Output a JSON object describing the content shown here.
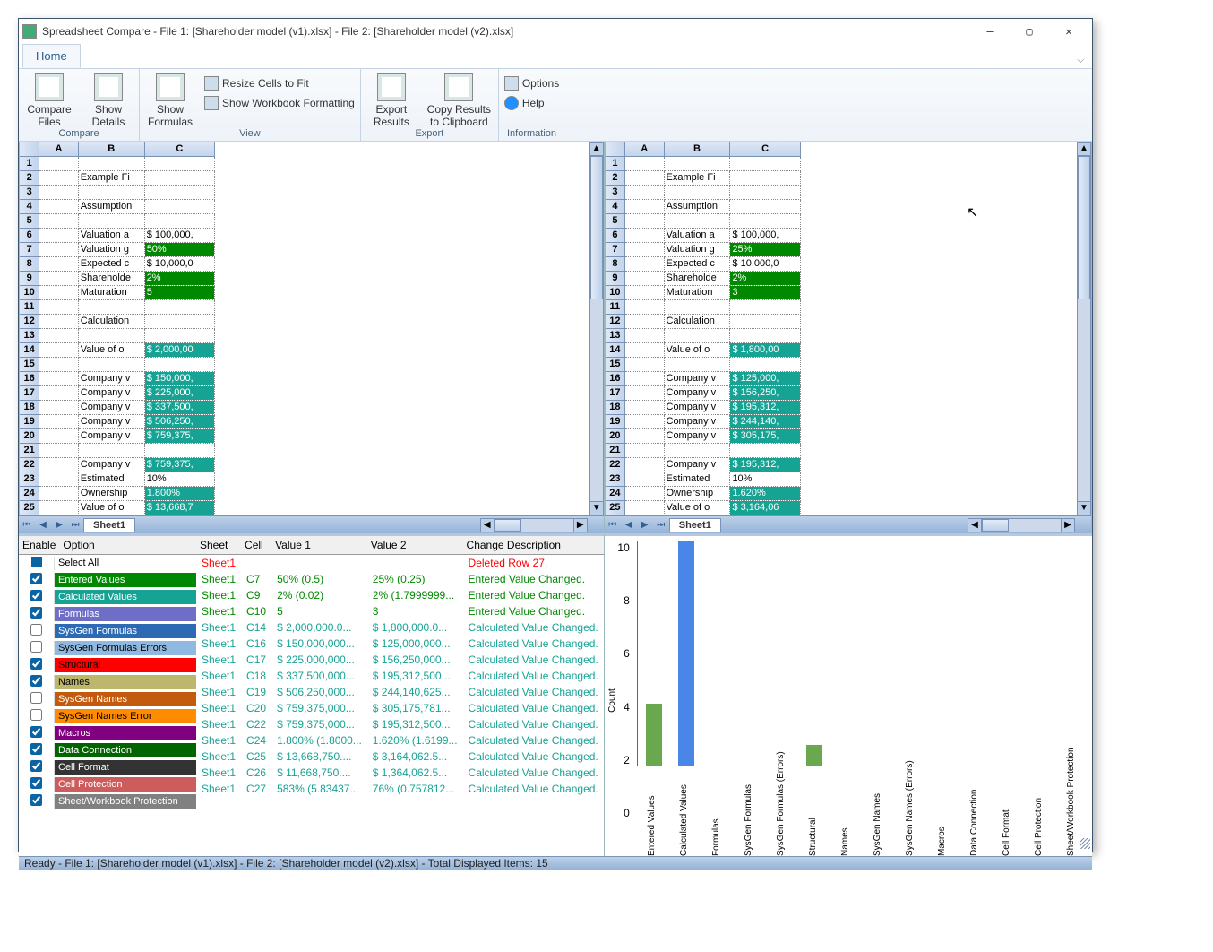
{
  "title": "Spreadsheet Compare - File 1: [Shareholder model (v1).xlsx] - File 2: [Shareholder model (v2).xlsx]",
  "ribbon": {
    "tab": "Home",
    "groups": {
      "compare": {
        "label": "Compare",
        "compare_files": "Compare Files",
        "show_details": "Show Details"
      },
      "view": {
        "label": "View",
        "show_formulas": "Show Formulas",
        "resize": "Resize Cells to Fit",
        "show_wb": "Show Workbook Formatting"
      },
      "export": {
        "label": "Export",
        "export_results": "Export Results",
        "copy_clip": "Copy Results to Clipboard"
      },
      "info": {
        "label": "Information",
        "options": "Options",
        "help": "Help"
      }
    }
  },
  "sheet_cols": [
    "A",
    "B",
    "C"
  ],
  "sheet1_rows": [
    [
      "1",
      "",
      "",
      ""
    ],
    [
      "2",
      "",
      "Example Fi",
      ""
    ],
    [
      "3",
      "",
      "",
      ""
    ],
    [
      "4",
      "",
      "Assumption",
      ""
    ],
    [
      "5",
      "",
      "",
      ""
    ],
    [
      "6",
      "",
      "Valuation a",
      "$ 100,000,"
    ],
    [
      "7",
      "",
      "Valuation g",
      "50%",
      "green"
    ],
    [
      "8",
      "",
      "Expected c",
      "$ 10,000,0"
    ],
    [
      "9",
      "",
      "Shareholde",
      "2%",
      "green"
    ],
    [
      "10",
      "",
      "Maturation",
      "5",
      "green"
    ],
    [
      "11",
      "",
      "",
      ""
    ],
    [
      "12",
      "",
      "Calculation",
      ""
    ],
    [
      "13",
      "",
      "",
      ""
    ],
    [
      "14",
      "",
      "Value of o",
      "$ 2,000,00",
      "teal"
    ],
    [
      "15",
      "",
      "",
      ""
    ],
    [
      "16",
      "",
      "Company v",
      "$ 150,000,",
      "teal"
    ],
    [
      "17",
      "",
      "Company v",
      "$ 225,000,",
      "teal"
    ],
    [
      "18",
      "",
      "Company v",
      "$ 337,500,",
      "teal"
    ],
    [
      "19",
      "",
      "Company v",
      "$ 506,250,",
      "teal"
    ],
    [
      "20",
      "",
      "Company v",
      "$ 759,375,",
      "teal"
    ],
    [
      "21",
      "",
      "",
      ""
    ],
    [
      "22",
      "",
      "Company v",
      "$ 759,375,",
      "teal"
    ],
    [
      "23",
      "",
      "Estimated",
      "10%"
    ],
    [
      "24",
      "",
      "Ownership",
      "1.800%",
      "teal"
    ],
    [
      "25",
      "",
      "Value of o",
      "$ 13,668,7",
      "teal"
    ]
  ],
  "sheet2_rows": [
    [
      "1",
      "",
      "",
      ""
    ],
    [
      "2",
      "",
      "Example Fi",
      ""
    ],
    [
      "3",
      "",
      "",
      ""
    ],
    [
      "4",
      "",
      "Assumption",
      ""
    ],
    [
      "5",
      "",
      "",
      ""
    ],
    [
      "6",
      "",
      "Valuation a",
      "$ 100,000,"
    ],
    [
      "7",
      "",
      "Valuation g",
      "25%",
      "green"
    ],
    [
      "8",
      "",
      "Expected c",
      "$ 10,000,0"
    ],
    [
      "9",
      "",
      "Shareholde",
      "2%",
      "green"
    ],
    [
      "10",
      "",
      "Maturation",
      "3",
      "green"
    ],
    [
      "11",
      "",
      "",
      ""
    ],
    [
      "12",
      "",
      "Calculation",
      ""
    ],
    [
      "13",
      "",
      "",
      ""
    ],
    [
      "14",
      "",
      "Value of o",
      "$ 1,800,00",
      "teal"
    ],
    [
      "15",
      "",
      "",
      ""
    ],
    [
      "16",
      "",
      "Company v",
      "$ 125,000,",
      "teal"
    ],
    [
      "17",
      "",
      "Company v",
      "$ 156,250,",
      "teal"
    ],
    [
      "18",
      "",
      "Company v",
      "$ 195,312,",
      "teal"
    ],
    [
      "19",
      "",
      "Company v",
      "$ 244,140,",
      "teal"
    ],
    [
      "20",
      "",
      "Company v",
      "$ 305,175,",
      "teal"
    ],
    [
      "21",
      "",
      "",
      ""
    ],
    [
      "22",
      "",
      "Company v",
      "$ 195,312,",
      "teal"
    ],
    [
      "23",
      "",
      "Estimated",
      "10%"
    ],
    [
      "24",
      "",
      "Ownership",
      "1.620%",
      "teal"
    ],
    [
      "25",
      "",
      "Value of o",
      "$ 3,164,06",
      "teal"
    ]
  ],
  "sheet_tab": "Sheet1",
  "options": {
    "header_enable": "Enable",
    "header_option": "Option",
    "items": [
      {
        "on": false,
        "label": "Select All",
        "bg": "#fff",
        "fg": "#000",
        "cb_blue": true
      },
      {
        "on": true,
        "label": "Entered Values",
        "bg": "#008800",
        "fg": "#fff"
      },
      {
        "on": true,
        "label": "Calculated Values",
        "bg": "#17a394",
        "fg": "#fff"
      },
      {
        "on": true,
        "label": "Formulas",
        "bg": "#6e6ec7",
        "fg": "#fff"
      },
      {
        "on": false,
        "label": "SysGen Formulas",
        "bg": "#2e69b3",
        "fg": "#fff"
      },
      {
        "on": false,
        "label": "SysGen Formulas Errors",
        "bg": "#8fb9e0",
        "fg": "#000"
      },
      {
        "on": true,
        "label": "Structural",
        "bg": "#ff0000",
        "fg": "#000"
      },
      {
        "on": true,
        "label": "Names",
        "bg": "#bdb76b",
        "fg": "#000"
      },
      {
        "on": false,
        "label": "SysGen Names",
        "bg": "#c45a0d",
        "fg": "#fff"
      },
      {
        "on": false,
        "label": "SysGen Names Error",
        "bg": "#ff8c00",
        "fg": "#000"
      },
      {
        "on": true,
        "label": "Macros",
        "bg": "#800080",
        "fg": "#fff"
      },
      {
        "on": true,
        "label": "Data Connection",
        "bg": "#006400",
        "fg": "#fff"
      },
      {
        "on": true,
        "label": "Cell Format",
        "bg": "#333333",
        "fg": "#fff"
      },
      {
        "on": true,
        "label": "Cell Protection",
        "bg": "#cd5c5c",
        "fg": "#fff"
      },
      {
        "on": true,
        "label": "Sheet/Workbook Protection",
        "bg": "#808080",
        "fg": "#fff"
      }
    ]
  },
  "results": {
    "headers": [
      "Sheet",
      "Cell",
      "Value 1",
      "Value 2",
      "Change Description"
    ],
    "rows": [
      {
        "s": "Sheet1",
        "c": "",
        "v1": "",
        "v2": "",
        "d": "Deleted Row 27.",
        "color": "#ff0000"
      },
      {
        "s": "Sheet1",
        "c": "C7",
        "v1": "50% (0.5)",
        "v2": "25% (0.25)",
        "d": "Entered Value Changed.",
        "color": "#008800"
      },
      {
        "s": "Sheet1",
        "c": "C9",
        "v1": "2% (0.02)",
        "v2": "2% (1.7999999...",
        "d": "Entered Value Changed.",
        "color": "#008800"
      },
      {
        "s": "Sheet1",
        "c": "C10",
        "v1": "5",
        "v2": "3",
        "d": "Entered Value Changed.",
        "color": "#008800"
      },
      {
        "s": "Sheet1",
        "c": "C14",
        "v1": "$ 2,000,000.0...",
        "v2": "$ 1,800,000.0...",
        "d": "Calculated Value Changed.",
        "color": "#17a394"
      },
      {
        "s": "Sheet1",
        "c": "C16",
        "v1": "$ 150,000,000...",
        "v2": "$ 125,000,000...",
        "d": "Calculated Value Changed.",
        "color": "#17a394"
      },
      {
        "s": "Sheet1",
        "c": "C17",
        "v1": "$ 225,000,000...",
        "v2": "$ 156,250,000...",
        "d": "Calculated Value Changed.",
        "color": "#17a394"
      },
      {
        "s": "Sheet1",
        "c": "C18",
        "v1": "$ 337,500,000...",
        "v2": "$ 195,312,500...",
        "d": "Calculated Value Changed.",
        "color": "#17a394"
      },
      {
        "s": "Sheet1",
        "c": "C19",
        "v1": "$ 506,250,000...",
        "v2": "$ 244,140,625...",
        "d": "Calculated Value Changed.",
        "color": "#17a394"
      },
      {
        "s": "Sheet1",
        "c": "C20",
        "v1": "$ 759,375,000...",
        "v2": "$ 305,175,781...",
        "d": "Calculated Value Changed.",
        "color": "#17a394"
      },
      {
        "s": "Sheet1",
        "c": "C22",
        "v1": "$ 759,375,000...",
        "v2": "$ 195,312,500...",
        "d": "Calculated Value Changed.",
        "color": "#17a394"
      },
      {
        "s": "Sheet1",
        "c": "C24",
        "v1": "1.800% (1.8000...",
        "v2": "1.620% (1.6199...",
        "d": "Calculated Value Changed.",
        "color": "#17a394"
      },
      {
        "s": "Sheet1",
        "c": "C25",
        "v1": "$ 13,668,750....",
        "v2": "$ 3,164,062.5...",
        "d": "Calculated Value Changed.",
        "color": "#17a394"
      },
      {
        "s": "Sheet1",
        "c": "C26",
        "v1": "$ 11,668,750....",
        "v2": "$ 1,364,062.5...",
        "d": "Calculated Value Changed.",
        "color": "#17a394"
      },
      {
        "s": "Sheet1",
        "c": "C27",
        "v1": "583% (5.83437...",
        "v2": "76% (0.757812...",
        "d": "Calculated Value Changed.",
        "color": "#17a394"
      }
    ]
  },
  "chart_data": {
    "type": "bar",
    "ylabel": "Count",
    "ylim": [
      0,
      11
    ],
    "ticks": [
      0,
      2,
      4,
      6,
      8,
      10
    ],
    "categories": [
      "Entered Values",
      "Calculated Values",
      "Formulas",
      "SysGen Formulas",
      "SysGen Formulas (Errors)",
      "Structural",
      "Names",
      "SysGen Names",
      "SysGen Names (Errors)",
      "Macros",
      "Data Connection",
      "Cell Format",
      "Cell Protection",
      "Sheet/Workbook Protection"
    ],
    "values": [
      3,
      11,
      0,
      0,
      0,
      1,
      0,
      0,
      0,
      0,
      0,
      0,
      0,
      0
    ],
    "colors": [
      "#6aa84f",
      "#4a86e8",
      "#6e6ec7",
      "#2e69b3",
      "#8fb9e0",
      "#6aa84f",
      "#bdb76b",
      "#c45a0d",
      "#ff8c00",
      "#800080",
      "#006400",
      "#333333",
      "#cd5c5c",
      "#808080"
    ]
  },
  "status": "Ready - File 1: [Shareholder model (v1).xlsx] - File 2: [Shareholder model (v2).xlsx] - Total Displayed Items: 15"
}
